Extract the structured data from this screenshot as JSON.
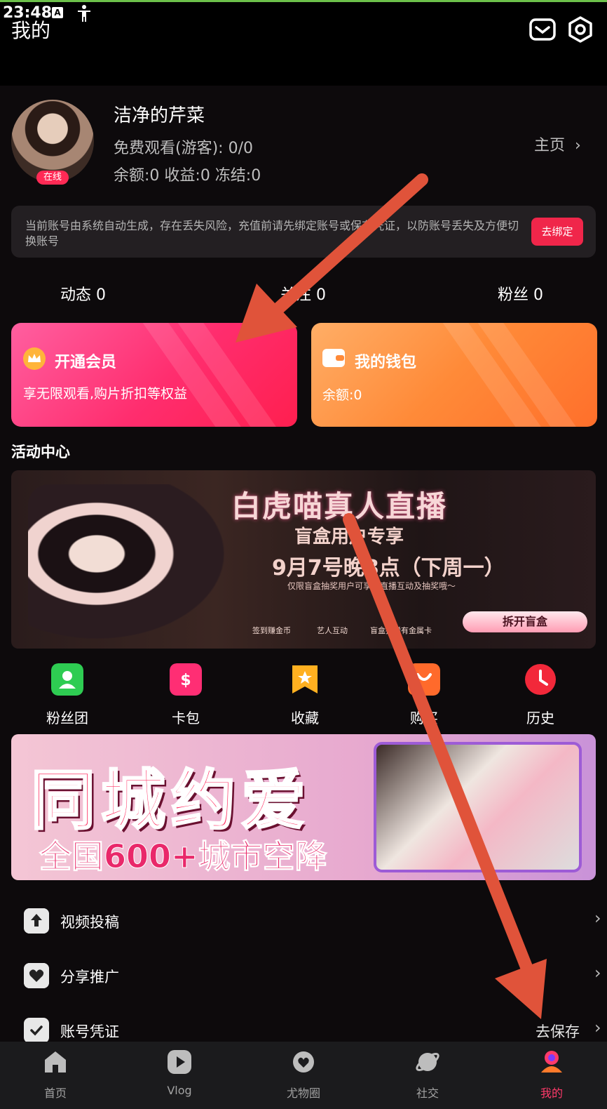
{
  "status": {
    "time": "23:48",
    "a_icon": "A"
  },
  "header": {
    "title": "我的",
    "mail_icon": "mail-icon",
    "settings_icon": "settings-icon"
  },
  "profile": {
    "name": "洁净的芹菜",
    "online_badge": "在线",
    "free_watch": "免费观看(游客): 0/0",
    "balance_line": "余额:0 收益:0 冻结:0",
    "homepage": "主页"
  },
  "notice": {
    "text": "当前账号由系统自动生成，存在丢失风险，充值前请先绑定账号或保存凭证，以防账号丢失及方便切换账号",
    "button": "去绑定"
  },
  "stats": {
    "dynamic": "动态 0",
    "follow": "关注 0",
    "fans": "粉丝 0"
  },
  "cards": {
    "vip_title": "开通会员",
    "vip_sub": "享无限观看,购片折扣等权益",
    "wallet_title": "我的钱包",
    "wallet_sub": "余额:0"
  },
  "activity": {
    "title": "活动中心",
    "banner1": {
      "title": "白虎喵真人直播",
      "sub": "盲盒用户专享",
      "date": "9月7号晚8点（下周一）",
      "small": "仅限盲盒抽奖用户可享受直播互动及抽奖哦～",
      "icons": [
        "签到赚金币",
        "艺人互动",
        "盲盒抽稀有金属卡"
      ],
      "button": "拆开盲盒"
    }
  },
  "quick": [
    {
      "label": "粉丝团",
      "color": "#2ecc52"
    },
    {
      "label": "卡包",
      "color": "#ff2e74"
    },
    {
      "label": "收藏",
      "color": "#ffb020"
    },
    {
      "label": "购买",
      "color": "#ff6a2b"
    },
    {
      "label": "历史",
      "color": "#f2283a"
    }
  ],
  "banner2": {
    "big": "同城约爱",
    "sub": "全国600+城市空降"
  },
  "rows": [
    {
      "label": "视频投稿"
    },
    {
      "label": "分享推广"
    },
    {
      "label": "账号凭证",
      "extra": "去保存"
    }
  ],
  "nav": [
    {
      "label": "首页"
    },
    {
      "label": "Vlog"
    },
    {
      "label": "尤物圈"
    },
    {
      "label": "社交"
    },
    {
      "label": "我的"
    }
  ],
  "colors": {
    "accent": "#ff3a6a",
    "annotation_arrow": "#e0533a"
  }
}
